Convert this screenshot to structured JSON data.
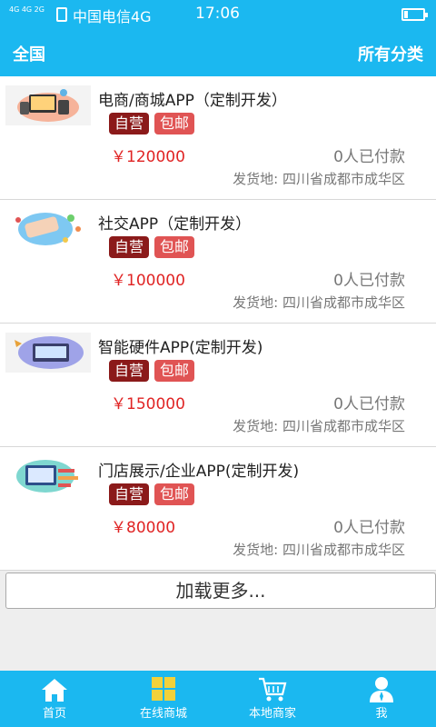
{
  "status_bar": {
    "network": "4G 4G 2G",
    "carrier": "中国电信4G",
    "time": "17:06"
  },
  "header": {
    "region": "全国",
    "categories": "所有分类"
  },
  "products": [
    {
      "title": "电商/商城APP（定制开发）",
      "tag_self": "自营",
      "tag_shipping": "包邮",
      "price": "￥120000",
      "paid": "0人已付款",
      "origin": "发货地: 四川省成都市成华区"
    },
    {
      "title": "社交APP（定制开发）",
      "tag_self": "自营",
      "tag_shipping": "包邮",
      "price": "￥100000",
      "paid": "0人已付款",
      "origin": "发货地: 四川省成都市成华区"
    },
    {
      "title": "智能硬件APP(定制开发)",
      "tag_self": "自营",
      "tag_shipping": "包邮",
      "price": "￥150000",
      "paid": "0人已付款",
      "origin": "发货地: 四川省成都市成华区"
    },
    {
      "title": "门店展示/企业APP(定制开发)",
      "tag_self": "自营",
      "tag_shipping": "包邮",
      "price": "￥80000",
      "paid": "0人已付款",
      "origin": "发货地: 四川省成都市成华区"
    }
  ],
  "load_more": "加载更多...",
  "tabs": [
    {
      "label": "首页",
      "icon": "home-icon"
    },
    {
      "label": "在线商城",
      "icon": "grid-icon"
    },
    {
      "label": "本地商家",
      "icon": "cart-icon"
    },
    {
      "label": "我",
      "icon": "user-icon"
    }
  ],
  "colors": {
    "primary": "#1bb8f0",
    "price": "#e02424",
    "tag_self": "#8b1a1a",
    "tag_shipping": "#e05454"
  }
}
